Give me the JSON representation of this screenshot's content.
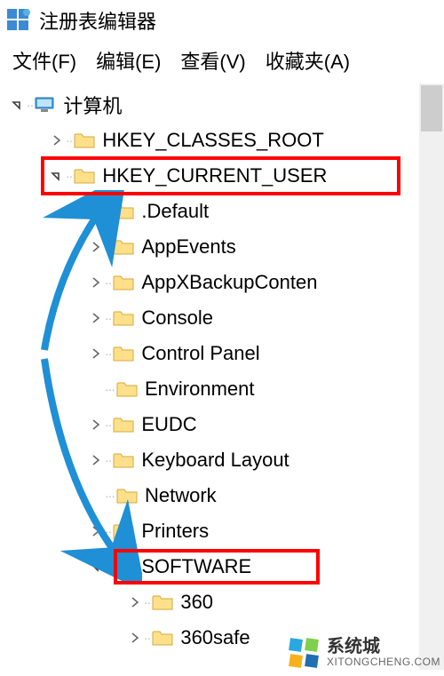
{
  "titlebar": {
    "title": "注册表编辑器"
  },
  "menubar": {
    "file": "文件(F)",
    "edit": "编辑(E)",
    "view": "查看(V)",
    "favorites": "收藏夹(A)"
  },
  "tree": {
    "root": "计算机",
    "hkcr": "HKEY_CLASSES_ROOT",
    "hkcu": "HKEY_CURRENT_USER",
    "default": ".Default",
    "appevents": "AppEvents",
    "appxbackup": "AppXBackupConten",
    "console": "Console",
    "controlpanel": "Control Panel",
    "environment": "Environment",
    "eudc": "EUDC",
    "keyboard": "Keyboard Layout",
    "network": "Network",
    "printers": "Printers",
    "software": "SOFTWARE",
    "s360": "360",
    "s360safe": "360safe"
  },
  "watermark": {
    "main": "系统城",
    "sub": "XITONGCHENG.COM"
  }
}
